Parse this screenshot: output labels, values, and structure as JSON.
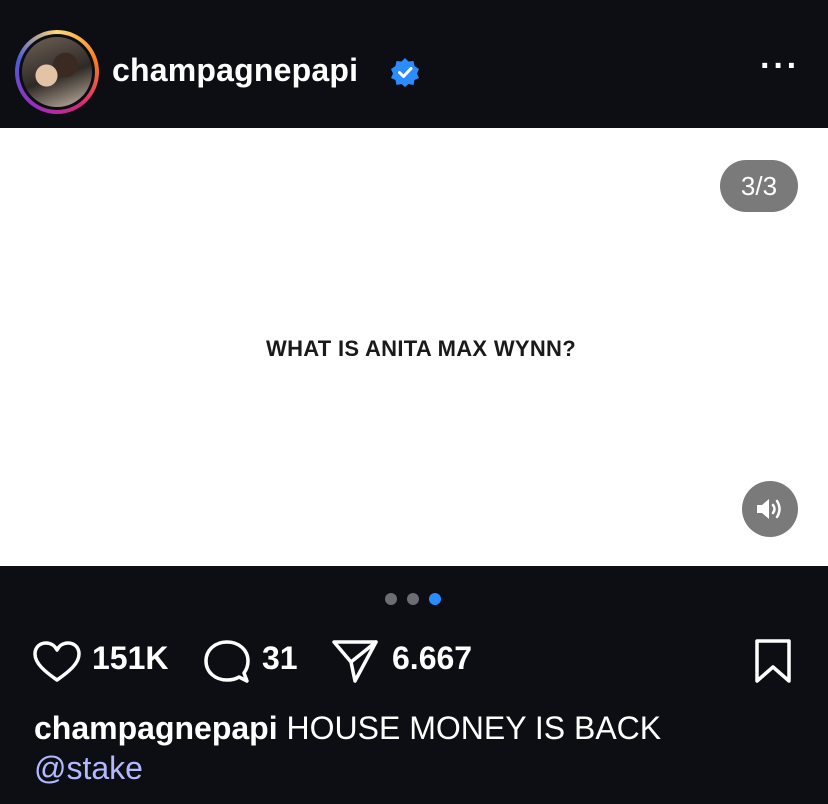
{
  "header": {
    "username": "champagnepapi",
    "verified_icon": "verified-badge-icon",
    "more_label": "···"
  },
  "media": {
    "counter": "3/3",
    "text": "WHAT IS ANITA MAX WYNN?",
    "sound_icon": "speaker-icon",
    "carousel_total": 3,
    "carousel_active": 3
  },
  "actions": {
    "likes": "151K",
    "comments": "31",
    "shares": "6.667"
  },
  "caption": {
    "username": "champagnepapi",
    "text": "HOUSE MONEY IS BACK",
    "mention": "@stake"
  },
  "colors": {
    "background": "#0c0e13",
    "accent_blue": "#2b8cff",
    "mention": "#b3b8ff"
  }
}
